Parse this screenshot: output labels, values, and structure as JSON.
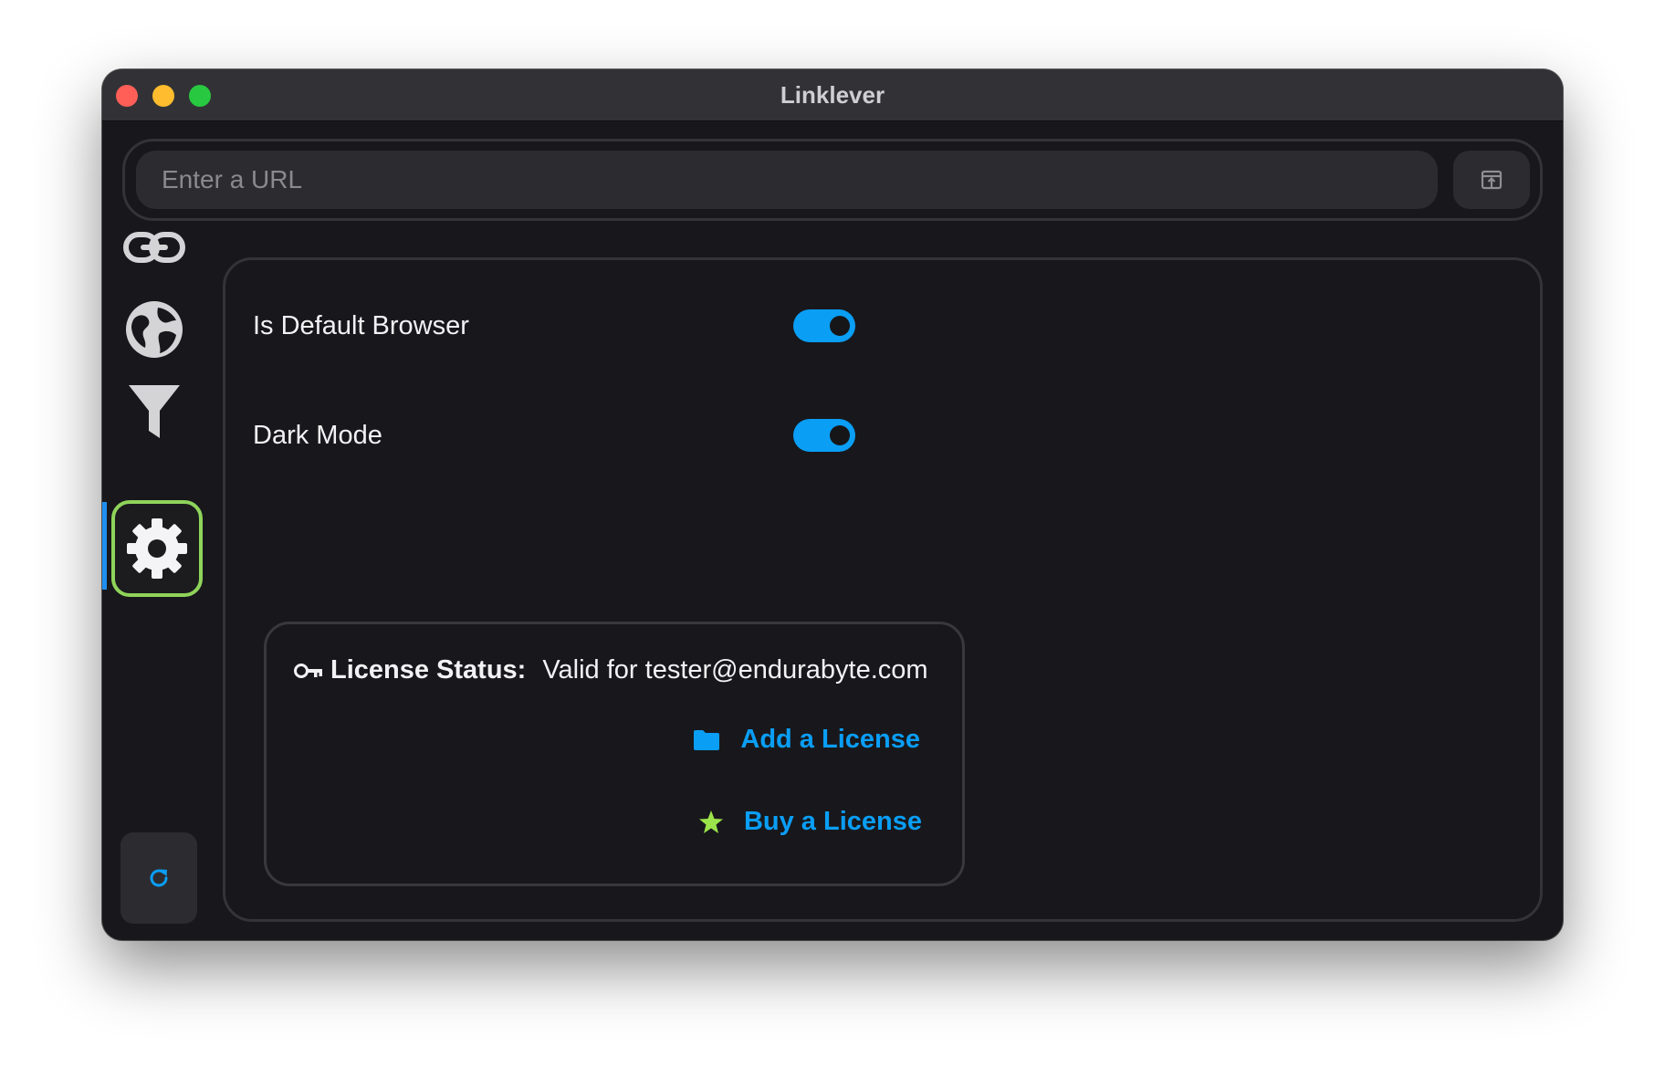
{
  "window": {
    "title": "Linklever"
  },
  "urlbar": {
    "placeholder": "Enter a URL"
  },
  "sidebar": {
    "items": [
      {
        "icon": "link-icon",
        "active": false
      },
      {
        "icon": "globe-icon",
        "active": false
      },
      {
        "icon": "filter-icon",
        "active": false
      },
      {
        "icon": "gear-icon",
        "active": true
      }
    ]
  },
  "settings": {
    "default_browser_label": "Is Default Browser",
    "default_browser_on": true,
    "dark_mode_label": "Dark Mode",
    "dark_mode_on": true
  },
  "license": {
    "status_label": "License Status:",
    "status_value": "Valid for tester@endurabyte.com",
    "add_label": "Add a License",
    "buy_label": "Buy a License"
  },
  "colors": {
    "accent": "#0a9ef5",
    "active_outline": "#8fd45a",
    "star": "#9be34a",
    "background": "#18181c"
  }
}
